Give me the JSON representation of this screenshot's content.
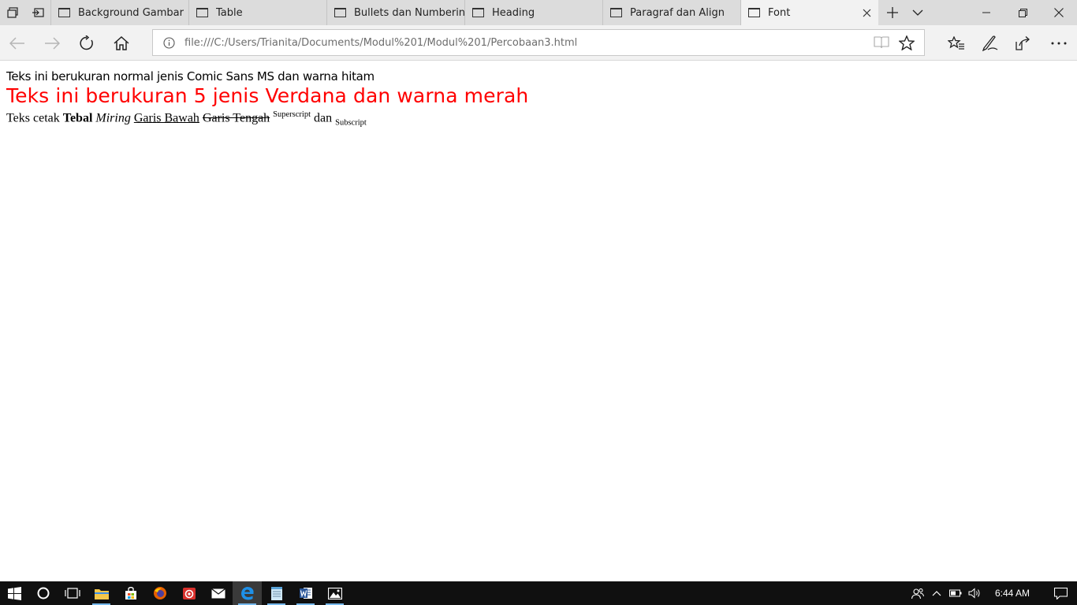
{
  "tabs": [
    {
      "label": "Background Gambar",
      "active": false
    },
    {
      "label": "Table",
      "active": false
    },
    {
      "label": "Bullets dan Numbering",
      "active": false
    },
    {
      "label": "Heading",
      "active": false
    },
    {
      "label": "Paragraf dan Align",
      "active": false
    },
    {
      "label": "Font",
      "active": true
    }
  ],
  "address": {
    "url": "file:///C:/Users/Trianita/Documents/Modul%201/Modul%201/Percobaan3.html"
  },
  "page": {
    "line1": "Teks ini berukuran normal jenis Comic Sans MS dan warna hitam",
    "line2": "Teks ini berukuran 5 jenis Verdana dan warna merah",
    "line3": {
      "prefix": "Teks cetak",
      "bold": "Tebal",
      "italic": "Miring",
      "underline": "Garis Bawah",
      "strike": "Garis Tengah",
      "superscript": "Superscript",
      "joiner": "dan",
      "subscript": "Subscript"
    },
    "line1_color": "#000000",
    "line2_color": "#ff0000"
  },
  "taskbar": {
    "apps": [
      "start-icon",
      "cortana-icon",
      "task-view-icon",
      "file-explorer-icon",
      "store-icon",
      "firefox-icon",
      "app-red-icon",
      "mail-icon",
      "edge-icon",
      "notepad-icon",
      "word-icon",
      "photos-icon"
    ],
    "time": "6:44 AM"
  }
}
